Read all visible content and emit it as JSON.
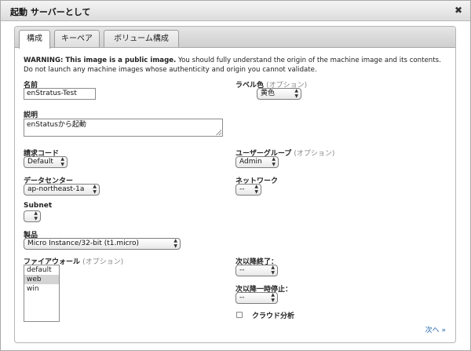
{
  "window": {
    "title": "起動 サーバーとして",
    "close_glyph": "✖"
  },
  "tabs": [
    {
      "label": "構成",
      "active": true
    },
    {
      "label": "キーペア",
      "active": false
    },
    {
      "label": "ボリューム構成",
      "active": false
    }
  ],
  "warning": {
    "prefix": "WARNING: This image is a public image.",
    "text": " You should fully understand the origin of the machine image and its contents. Do not launch any machine images whose authenticity and origin you cannot validate."
  },
  "form": {
    "name": {
      "label": "名前",
      "value": "enStratus-Test"
    },
    "label_color": {
      "label": "ラベル色",
      "optional": "(オプション)",
      "value": "黄色"
    },
    "description": {
      "label": "説明",
      "value": "enStatusから起動"
    },
    "billing_code": {
      "label": "請求コード",
      "value": "Default"
    },
    "user_group": {
      "label": "ユーザーグループ",
      "optional": "(オプション)",
      "value": "Admin"
    },
    "datacenter": {
      "label": "データセンター",
      "value": "ap-northeast-1a"
    },
    "network": {
      "label": "ネットワーク",
      "value": "--"
    },
    "subnet": {
      "label": "Subnet",
      "value": ""
    },
    "product": {
      "label": "製品",
      "value": "Micro Instance/32-bit (t1.micro)"
    },
    "firewall": {
      "label": "ファイアウォール",
      "optional": "(オプション)",
      "options": [
        "default",
        "web",
        "win"
      ],
      "selected": "web"
    },
    "terminate_after": {
      "label": "次以降終了：",
      "value": "--"
    },
    "pause_after": {
      "label": "次以降一時停止：",
      "value": "--"
    },
    "cloud_analytics": {
      "label": "クラウド分析",
      "checked": false
    }
  },
  "footer": {
    "next_label": "次へ »"
  }
}
